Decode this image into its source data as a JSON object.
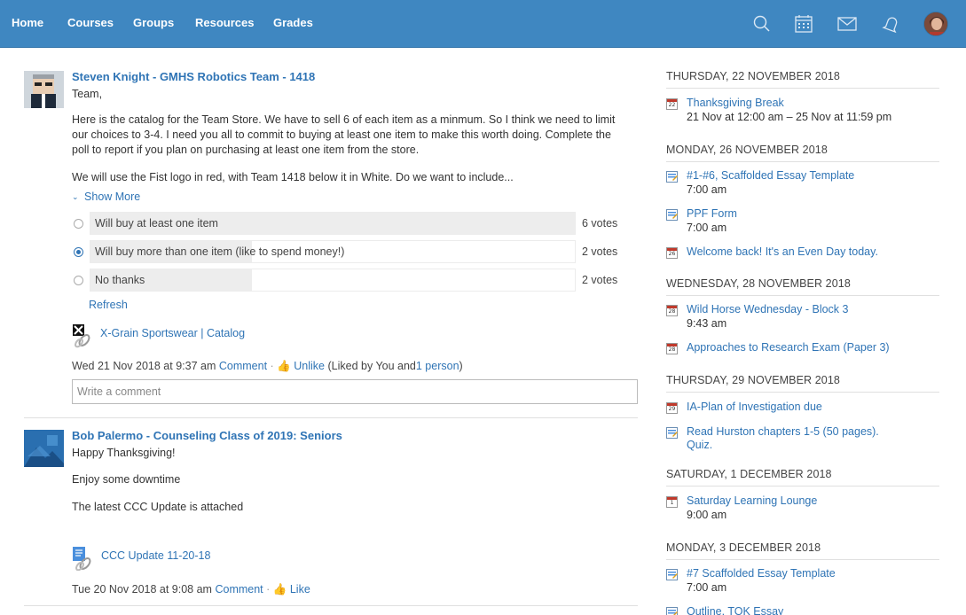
{
  "nav": {
    "items": [
      "Home",
      "Courses",
      "Groups",
      "Resources",
      "Grades"
    ],
    "icons": [
      "search-icon",
      "calendar-icon",
      "mail-icon",
      "notifications-icon"
    ]
  },
  "colors": {
    "topbar": "#3f87c1",
    "link": "#2f74b5",
    "poll_bar": "#ededed"
  },
  "posts": [
    {
      "author": "Steven Knight - GMHS Robotics Team - 1418",
      "lines": [
        "Team,",
        "Here is the catalog for the Team Store. We have to sell 6 of each item as a minmum. So I think we need to limit our choices to 3-4. I need you all to commit to buying at least one item to make this worth doing. Complete the poll to report if you plan on purchasing at least one item from the store.",
        "We will use the Fist logo in red, with Team 1418 below it in White. Do we want to include..."
      ],
      "show_more": "Show More",
      "poll": [
        {
          "label": "Will buy at least one item",
          "votes": "6 votes",
          "fraction": 1.0,
          "selected": false
        },
        {
          "label": "Will buy more than one item (like to spend money!)",
          "votes": "2 votes",
          "fraction": 0.333,
          "selected": true
        },
        {
          "label": "No thanks",
          "votes": "2 votes",
          "fraction": 0.333,
          "selected": false
        }
      ],
      "refresh": "Refresh",
      "attachment": "X-Grain Sportswear | Catalog",
      "timestamp": "Wed 21 Nov 2018 at 9:37 am",
      "comment": "Comment",
      "like": "Unlike",
      "liked_by_prefix": "(Liked by You and",
      "liked_by_link": "1 person",
      "liked_by_suffix": ")",
      "comment_placeholder": "Write a comment"
    },
    {
      "author": "Bob Palermo - Counseling Class of 2019: Seniors",
      "lines": [
        "Happy Thanksgiving!",
        "Enjoy some downtime",
        "The latest CCC Update is attached"
      ],
      "attachment": "CCC Update 11-20-18",
      "timestamp": "Tue 20 Nov 2018 at 9:08 am",
      "comment": "Comment",
      "like": "Like"
    }
  ],
  "calendar": [
    {
      "day": "THURSDAY, 22 NOVEMBER 2018",
      "events": [
        {
          "icon": "calendar-22-icon",
          "num": "22",
          "title": "Thanksgiving Break",
          "time": "21 Nov at 12:00 am – 25 Nov at 11:59 pm"
        }
      ]
    },
    {
      "day": "MONDAY, 26 NOVEMBER 2018",
      "events": [
        {
          "icon": "assignment-icon",
          "title": "#1-#6, Scaffolded Essay Template",
          "time": "7:00 am"
        },
        {
          "icon": "assignment-icon",
          "title": "PPF Form",
          "time": "7:00 am"
        },
        {
          "icon": "calendar-26-icon",
          "num": "26",
          "title": "Welcome back! It's an Even Day today.",
          "time": ""
        }
      ]
    },
    {
      "day": "WEDNESDAY, 28 NOVEMBER 2018",
      "events": [
        {
          "icon": "calendar-28-icon",
          "num": "28",
          "title": "Wild Horse Wednesday - Block 3",
          "time": "9:43 am"
        },
        {
          "icon": "calendar-28-icon",
          "num": "28",
          "title": "Approaches to Research Exam (Paper 3)",
          "time": ""
        }
      ]
    },
    {
      "day": "THURSDAY, 29 NOVEMBER 2018",
      "events": [
        {
          "icon": "calendar-29-icon",
          "num": "29",
          "title": "IA-Plan of Investigation due",
          "time": ""
        },
        {
          "icon": "assignment-icon",
          "title": "Read Hurston chapters 1-5 (50 pages). Quiz.",
          "time": ""
        }
      ]
    },
    {
      "day": "SATURDAY, 1 DECEMBER 2018",
      "events": [
        {
          "icon": "calendar-1-icon",
          "num": "1",
          "title": "Saturday Learning Lounge",
          "time": "9:00 am"
        }
      ]
    },
    {
      "day": "MONDAY, 3 DECEMBER 2018",
      "events": [
        {
          "icon": "assignment-icon",
          "title": "#7 Scaffolded Essay Template",
          "time": "7:00 am"
        },
        {
          "icon": "assignment-icon",
          "title": "Outline, TOK Essay",
          "time": ""
        }
      ]
    }
  ]
}
